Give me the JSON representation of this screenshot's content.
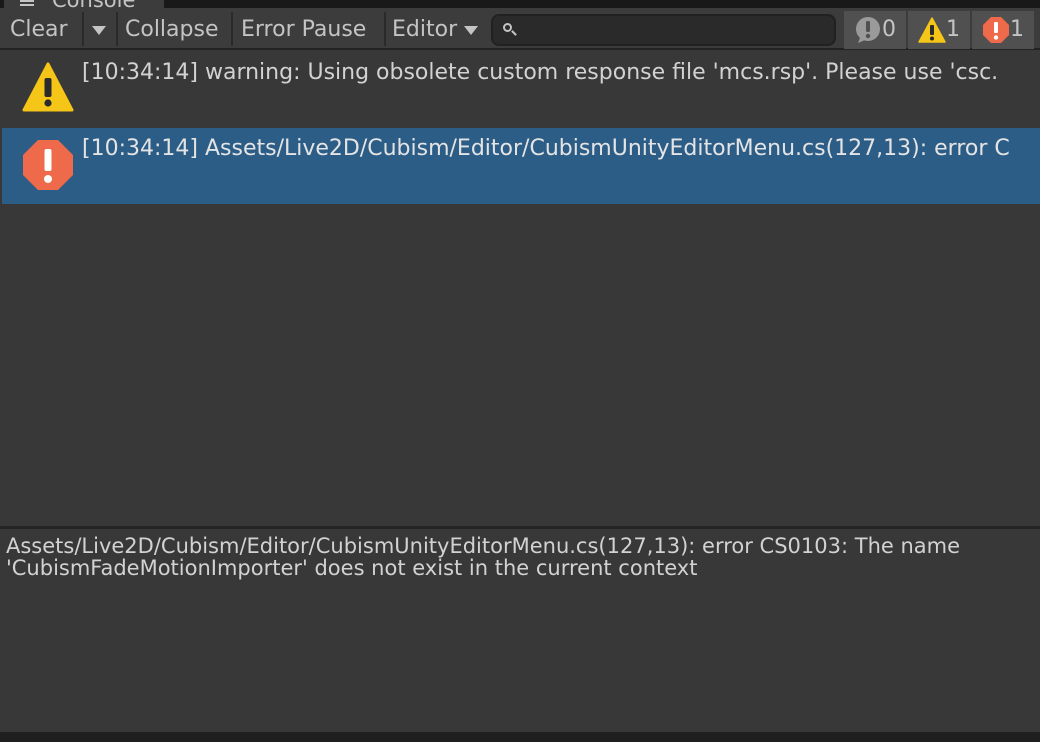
{
  "window": {
    "tab_title": "Console",
    "tab_icon": "hamburger-icon"
  },
  "toolbar": {
    "clear_label": "Clear",
    "collapse_label": "Collapse",
    "error_pause_label": "Error Pause",
    "editor_label": "Editor",
    "search_placeholder": "",
    "search_value": "",
    "log_count": "0",
    "warning_count": "1",
    "error_count": "1"
  },
  "logs": [
    {
      "type": "warning",
      "icon": "warning-icon",
      "text": "[10:34:14] warning: Using obsolete custom response file 'mcs.rsp'. Please use 'csc.",
      "selected": false
    },
    {
      "type": "error",
      "icon": "error-icon",
      "text": "[10:34:14] Assets/Live2D/Cubism/Editor/CubismUnityEditorMenu.cs(127,13): error C",
      "selected": true
    }
  ],
  "detail": {
    "text": "Assets/Live2D/Cubism/Editor/CubismUnityEditorMenu.cs(127,13): error CS0103: The name 'CubismFadeMotionImporter' does not exist in the current context"
  },
  "colors": {
    "warning": "#f5c518",
    "error": "#ef6a4a",
    "selected_row": "#2c5d87"
  }
}
